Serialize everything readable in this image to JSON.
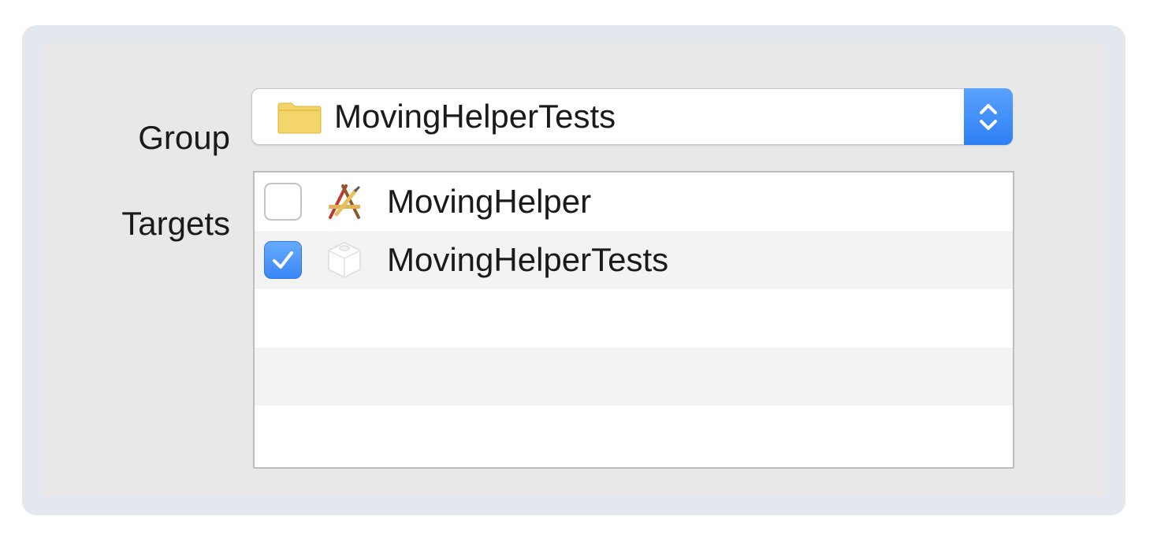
{
  "group": {
    "label": "Group",
    "selected": "MovingHelperTests",
    "icon": "folder-icon"
  },
  "targets": {
    "label": "Targets",
    "items": [
      {
        "name": "MovingHelper",
        "checked": false,
        "icon": "app-target-icon"
      },
      {
        "name": "MovingHelperTests",
        "checked": true,
        "icon": "test-bundle-icon"
      }
    ]
  },
  "colors": {
    "accent": "#3a86f5",
    "panel_bg": "#e8e8e8",
    "frame_bg": "#e3e7ee",
    "folder": "#f3d569"
  }
}
